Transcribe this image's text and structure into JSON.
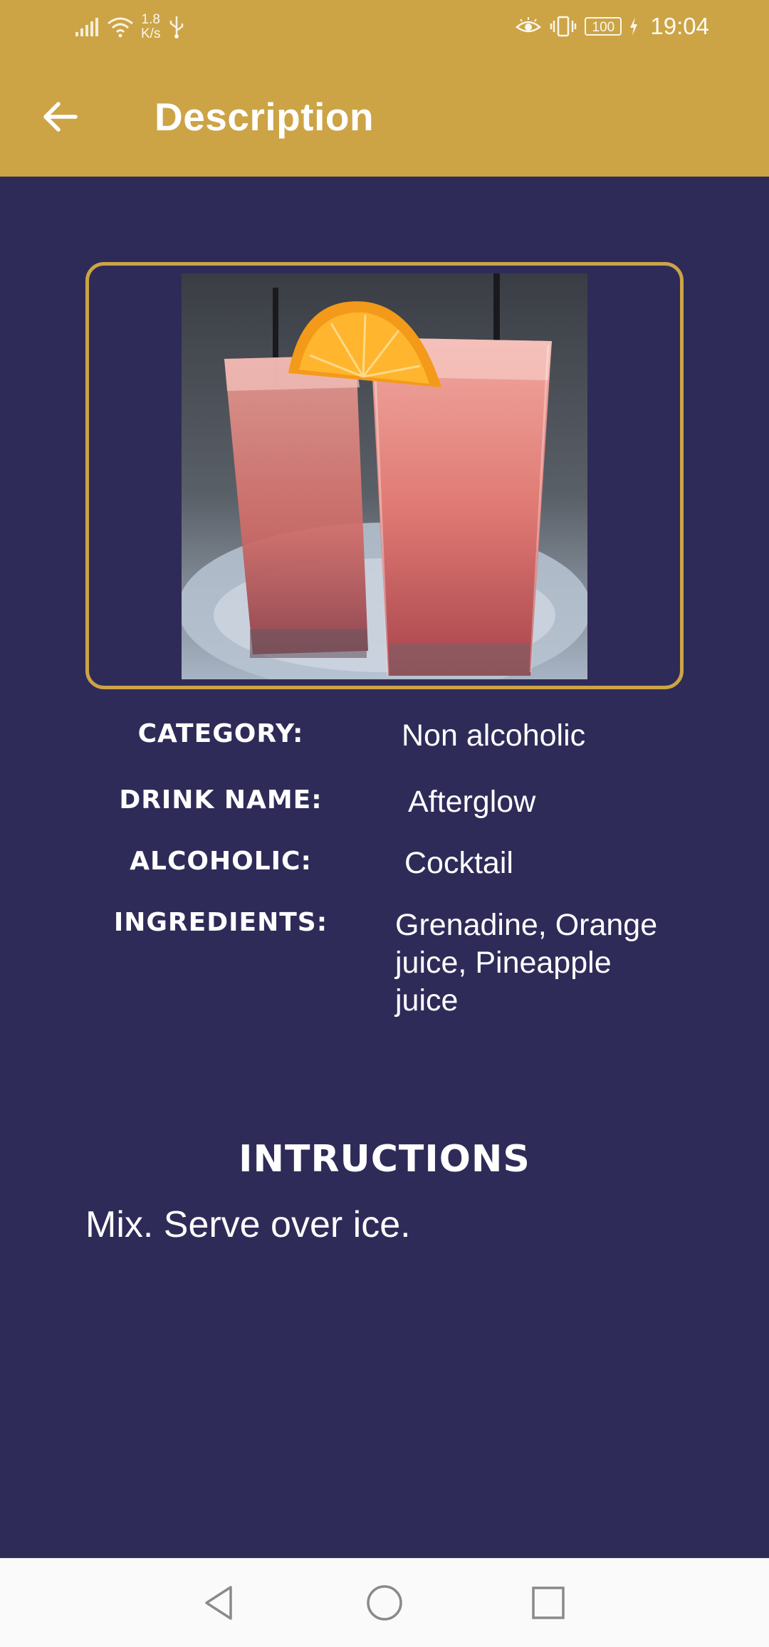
{
  "status_bar": {
    "network_speed": "1.8",
    "network_speed_unit": "K/s",
    "battery": "100",
    "time": "19:04"
  },
  "app_bar": {
    "title": "Description"
  },
  "drink": {
    "category_label": "CATEGORY:",
    "category": "Non alcoholic",
    "name_label": "DRINK NAME:",
    "name": "Afterglow",
    "alcoholic_label": "ALCOHOLIC:",
    "alcoholic": "Cocktail",
    "ingredients_label": "INGREDIENTS:",
    "ingredients_line1": "Grenadine, Orange",
    "ingredients_line2": "juice, Pineapple",
    "ingredients_line3": "juice"
  },
  "instructions": {
    "title": "INTRUCTIONS",
    "text": "Mix. Serve over ice."
  },
  "colors": {
    "app_bar": "#cca446",
    "background": "#2f2b58",
    "accent_border": "#cca446",
    "nav_bar": "#fafafa"
  },
  "icons": {
    "back": "arrow-left-icon",
    "nav_back": "triangle-back-icon",
    "nav_home": "circle-home-icon",
    "nav_recents": "square-recents-icon"
  }
}
